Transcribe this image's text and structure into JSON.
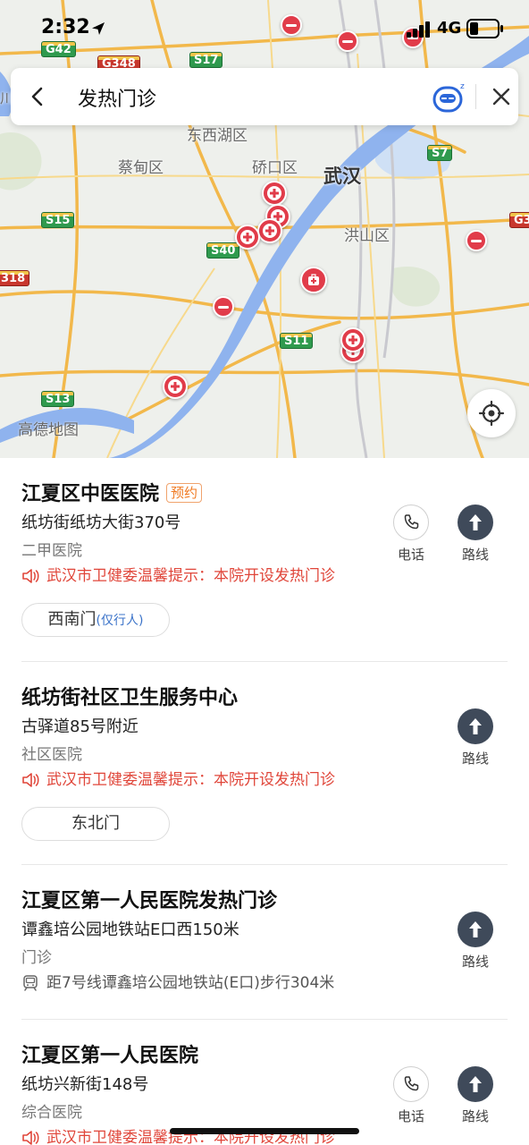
{
  "status_bar": {
    "time": "2:32",
    "network": "4G"
  },
  "search": {
    "query": "发热门诊"
  },
  "map": {
    "labels": {
      "dongxihu": "东西湖区",
      "caidian": "蔡甸区",
      "qiaokou": "硚口区",
      "wuhan": "武汉",
      "hongshan": "洪山区"
    },
    "road_shields": {
      "g42": "G42",
      "g348": "G348",
      "s17": "S17",
      "s7": "S7",
      "g3": "G3",
      "s15": "S15",
      "s40": "S40",
      "s11": "S11",
      "s13": "S13",
      "e318": "318",
      "left_edge": "川"
    },
    "logo": "高德地图"
  },
  "results": [
    {
      "name": "江夏区中医医院",
      "badge": "预约",
      "address": "纸坊街纸坊大街370号",
      "type": "二甲医院",
      "notice": "武汉市卫健委温馨提示：本院开设发热门诊",
      "gate": "西南门",
      "gate_note": "(仅行人)",
      "phone_label": "电话",
      "route_label": "路线"
    },
    {
      "name": "纸坊街社区卫生服务中心",
      "address": "古驿道85号附近",
      "type": "社区医院",
      "notice": "武汉市卫健委温馨提示：本院开设发热门诊",
      "gate": "东北门",
      "route_label": "路线"
    },
    {
      "name": "江夏区第一人民医院发热门诊",
      "address": "谭鑫培公园地铁站E口西150米",
      "type": "门诊",
      "metro": "距7号线谭鑫培公园地铁站(E口)步行304米",
      "route_label": "路线"
    },
    {
      "name": "江夏区第一人民医院",
      "address": "纸坊兴新街148号",
      "type": "综合医院",
      "notice": "武汉市卫健委温馨提示：本院开设发热门诊",
      "phone_label": "电话",
      "route_label": "路线"
    }
  ],
  "colors": {
    "accent_red": "#e13c4a",
    "notice_red": "#e0463a",
    "river": "#8fb3ee",
    "road": "#f2b84b"
  }
}
